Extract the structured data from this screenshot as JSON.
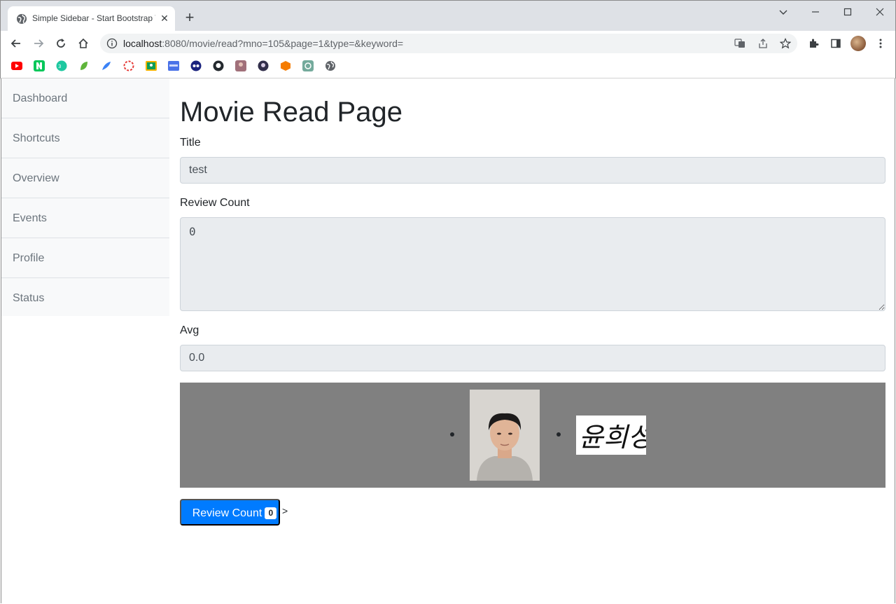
{
  "browser": {
    "tab_title": "Simple Sidebar - Start Bootstrap Template",
    "tab_close": "✕",
    "new_tab": "+",
    "url_host": "localhost",
    "url_rest": ":8080/movie/read?mno=105&page=1&type=&keyword="
  },
  "sidebar": {
    "items": [
      {
        "label": "Dashboard"
      },
      {
        "label": "Shortcuts"
      },
      {
        "label": "Overview"
      },
      {
        "label": "Events"
      },
      {
        "label": "Profile"
      },
      {
        "label": "Status"
      }
    ]
  },
  "main": {
    "title": "Movie Read Page",
    "fields": {
      "title": {
        "label": "Title",
        "value": "test"
      },
      "review_count": {
        "label": "Review Count",
        "value": "0"
      },
      "avg": {
        "label": "Avg",
        "value": "0.0"
      }
    },
    "gallery": {
      "signature_text": "윤희성"
    },
    "review_button": {
      "label": "Review Count",
      "badge": "0"
    },
    "stray_text": ">"
  },
  "colors": {
    "primary": "#007bff",
    "sidebar_bg": "#f8f9fa",
    "field_bg": "#e9ecef",
    "gallery_bg": "#808080"
  }
}
